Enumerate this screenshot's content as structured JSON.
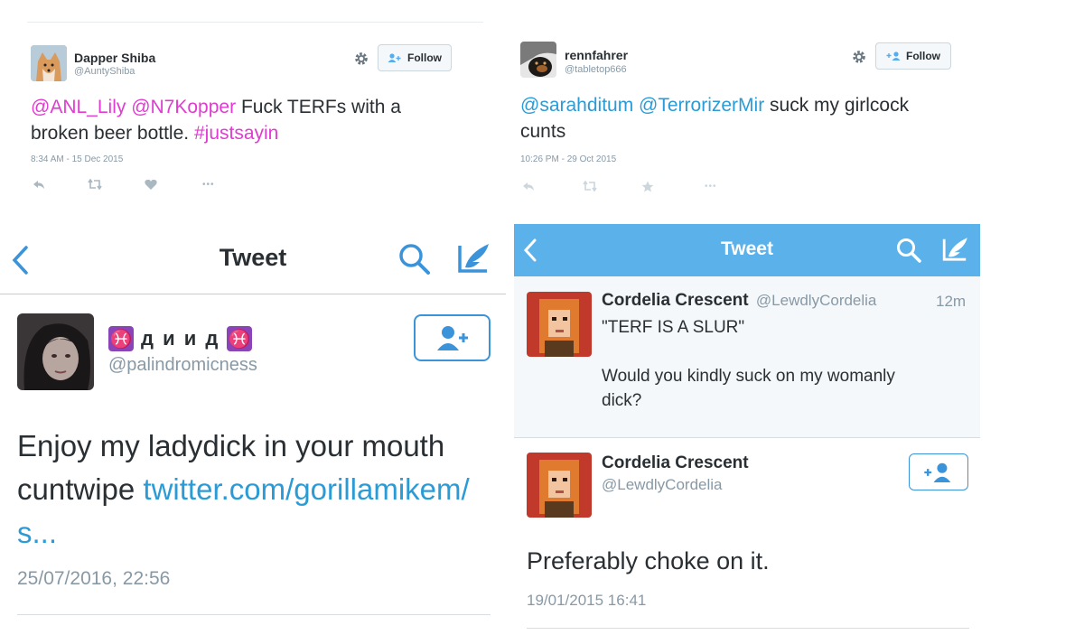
{
  "tl": {
    "name": "Dapper Shiba",
    "handle": "@AuntyShiba",
    "follow": "Follow",
    "m1": "@ANL_Lily",
    "m2": "@N7Kopper",
    "t1": "Fuck TERFs with a",
    "t2": "broken beer bottle.",
    "tag": "#justsayin",
    "time": "8:34 AM - 15 Dec 2015",
    "more": "•••"
  },
  "tr": {
    "name": "rennfahrer",
    "handle": "@tabletop666",
    "follow": "Follow",
    "m1": "@sarahditum",
    "m2": "@TerrorizerMir",
    "t1": "suck my girlcock",
    "t2": "cunts",
    "time": "10:26 PM - 29 Oct 2015",
    "more": "•••"
  },
  "bl": {
    "nav_title": "Tweet",
    "back": "‹",
    "pisces1": "♓",
    "name": "д и и д",
    "pisces2": "♓",
    "handle": "@palindromicness",
    "t1": "Enjoy my ladydick in your mouth",
    "t2": "cuntwipe",
    "link1": "twitter.com/gorillamikem/",
    "link2": "s...",
    "time": "25/07/2016, 22:56"
  },
  "br": {
    "nav_title": "Tweet",
    "back": "‹",
    "p_name": "Cordelia Crescent",
    "p_handle": "@LewdlyCordelia",
    "p_time": "12m",
    "p_t1": "\"TERF IS A SLUR\"",
    "p_t2": "Would you kindly suck on my womanly",
    "p_t3": "dick?",
    "name": "Cordelia Crescent",
    "handle": "@LewdlyCordelia",
    "t": "Preferably choke on it.",
    "time": "19/01/2015 16:41"
  },
  "colors": {
    "accent": "#55acee",
    "mention_pink": "#e13bd1",
    "link_blue": "#2b9bd6",
    "nav_blue": "#5bb2ea"
  }
}
